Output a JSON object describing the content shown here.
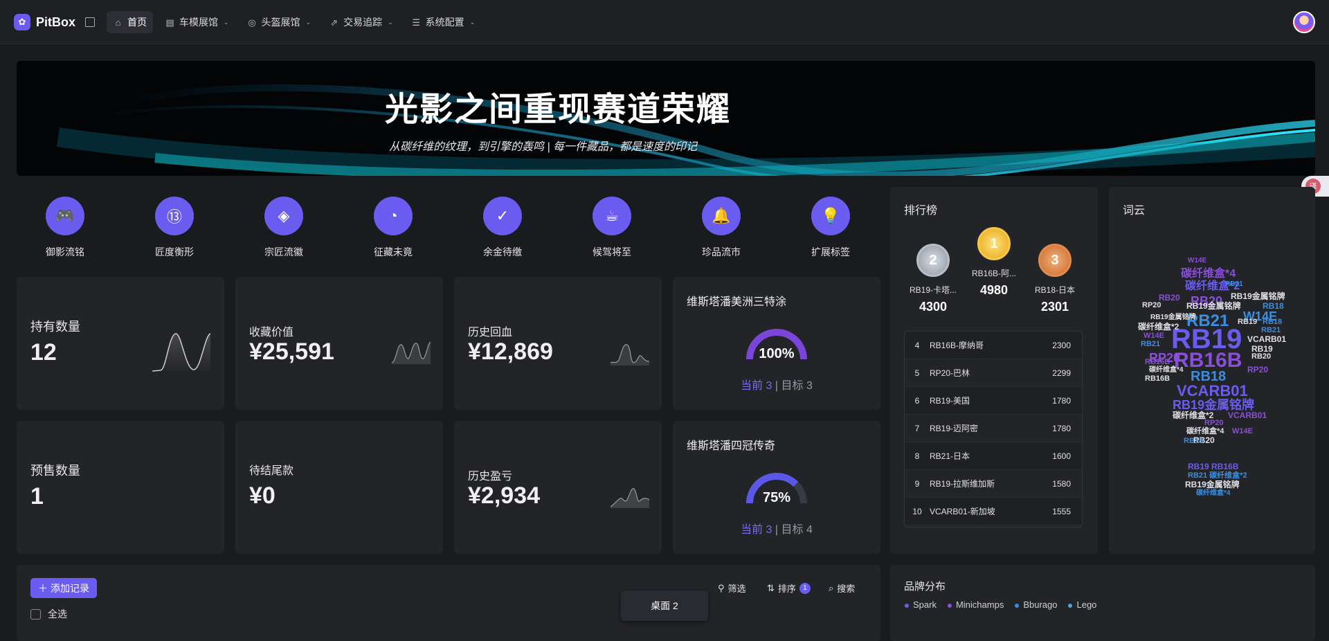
{
  "app": {
    "name": "PitBox"
  },
  "nav": {
    "items": [
      {
        "label": "首页",
        "icon": "home-icon"
      },
      {
        "label": "车模展馆",
        "icon": "chart-icon"
      },
      {
        "label": "头盔展馆",
        "icon": "globe-icon"
      },
      {
        "label": "交易追踪",
        "icon": "tracking-icon"
      },
      {
        "label": "系统配置",
        "icon": "server-icon"
      }
    ]
  },
  "banner": {
    "title": "光影之间重现赛道荣耀",
    "subtitle": "从碳纤维的纹理，到引擎的轰鸣 | 每一件藏品，都是速度的印记"
  },
  "quick_actions": [
    {
      "label": "御影流铭",
      "icon": "gamepad-icon"
    },
    {
      "label": "匠度衡形",
      "icon": "counter-icon"
    },
    {
      "label": "宗匠流徽",
      "icon": "tag-icon"
    },
    {
      "label": "征藏未竟",
      "icon": "gauge-icon"
    },
    {
      "label": "余金待缴",
      "icon": "receipt-check-icon"
    },
    {
      "label": "候驾将至",
      "icon": "coffee-icon"
    },
    {
      "label": "珍品流市",
      "icon": "bell-icon"
    },
    {
      "label": "扩展标签",
      "icon": "lightbulb-icon"
    }
  ],
  "stats": {
    "holding": {
      "label": "持有数量",
      "value": "12"
    },
    "value": {
      "label": "收藏价值",
      "value": "¥25,591"
    },
    "recovered": {
      "label": "历史回血",
      "value": "¥12,869"
    },
    "presale": {
      "label": "预售数量",
      "value": "1"
    },
    "pending": {
      "label": "待结尾款",
      "value": "¥0"
    },
    "pnl": {
      "label": "历史盈亏",
      "value": "¥2,934"
    }
  },
  "goals": [
    {
      "title": "维斯塔潘美洲三特涂",
      "percent_text": "100%",
      "percent": 1.0,
      "current": "当前 3",
      "sep": "|",
      "target": "目标 3"
    },
    {
      "title": "维斯塔潘四冠传奇",
      "percent_text": "75%",
      "percent": 0.75,
      "current": "当前 3",
      "sep": "|",
      "target": "目标 4"
    }
  ],
  "ranking": {
    "title": "排行榜",
    "podium": [
      {
        "rank": "2",
        "name": "RB19-卡塔...",
        "score": "4300"
      },
      {
        "rank": "1",
        "name": "RB16B-阿...",
        "score": "4980"
      },
      {
        "rank": "3",
        "name": "RB18-日本",
        "score": "2301"
      }
    ],
    "rows": [
      {
        "n": "4",
        "name": "RB16B-摩纳哥",
        "score": "2300"
      },
      {
        "n": "5",
        "name": "RP20-巴林",
        "score": "2299"
      },
      {
        "n": "6",
        "name": "RB19-美国",
        "score": "1780"
      },
      {
        "n": "7",
        "name": "RB19-迈阿密",
        "score": "1780"
      },
      {
        "n": "8",
        "name": "RB21-日本",
        "score": "1600"
      },
      {
        "n": "9",
        "name": "RB19-拉斯维加斯",
        "score": "1580"
      },
      {
        "n": "10",
        "name": "VCARB01-新加坡",
        "score": "1555"
      }
    ]
  },
  "wordcloud": {
    "title": "词云",
    "words": [
      "RB19",
      "RB16B",
      "VCARB01",
      "RB19金属铭牌",
      "碳纤维盒*2",
      "碳纤维盒*4",
      "RB21",
      "RB20",
      "RP20",
      "RB18",
      "W14E",
      "RB19金属铭牌",
      "碳纤维盒*2",
      "VCARB01",
      "RB20",
      "RB18",
      "W14E",
      "RP20",
      "RB21",
      "RB16B",
      "RB19",
      "RB20",
      "RB18",
      "RB21",
      "W14E",
      "RP20",
      "碳纤维盒*2",
      "碳纤维盒*4",
      "RB19金属铭牌",
      "VCARB01",
      "RB16B",
      "RB19",
      "RB20",
      "RB18",
      "RB21",
      "RP20",
      "W14E",
      "RB19金属铭牌",
      "碳纤维盒*4",
      "RB19 RB16B",
      "RB21 碳纤维盒*2",
      "RB19金属铭牌",
      "碳纤维盒*4"
    ]
  },
  "records": {
    "add_label": "添加记录",
    "select_all": "全选",
    "filter": "筛选",
    "sort": "排序",
    "sort_badge": "1",
    "search": "搜索"
  },
  "desktop_tooltip": "桌面 2",
  "brand": {
    "title": "品牌分布",
    "legend": [
      {
        "name": "Spark",
        "color": "#6b5cf0"
      },
      {
        "name": "Minichamps",
        "color": "#8a4fd8"
      },
      {
        "name": "Bburago",
        "color": "#3a8ee0"
      },
      {
        "name": "Lego",
        "color": "#4aa6d8"
      }
    ]
  },
  "colors": {
    "accent": "#6b5cf0",
    "card": "#232428",
    "bg": "#1a1b1f"
  }
}
